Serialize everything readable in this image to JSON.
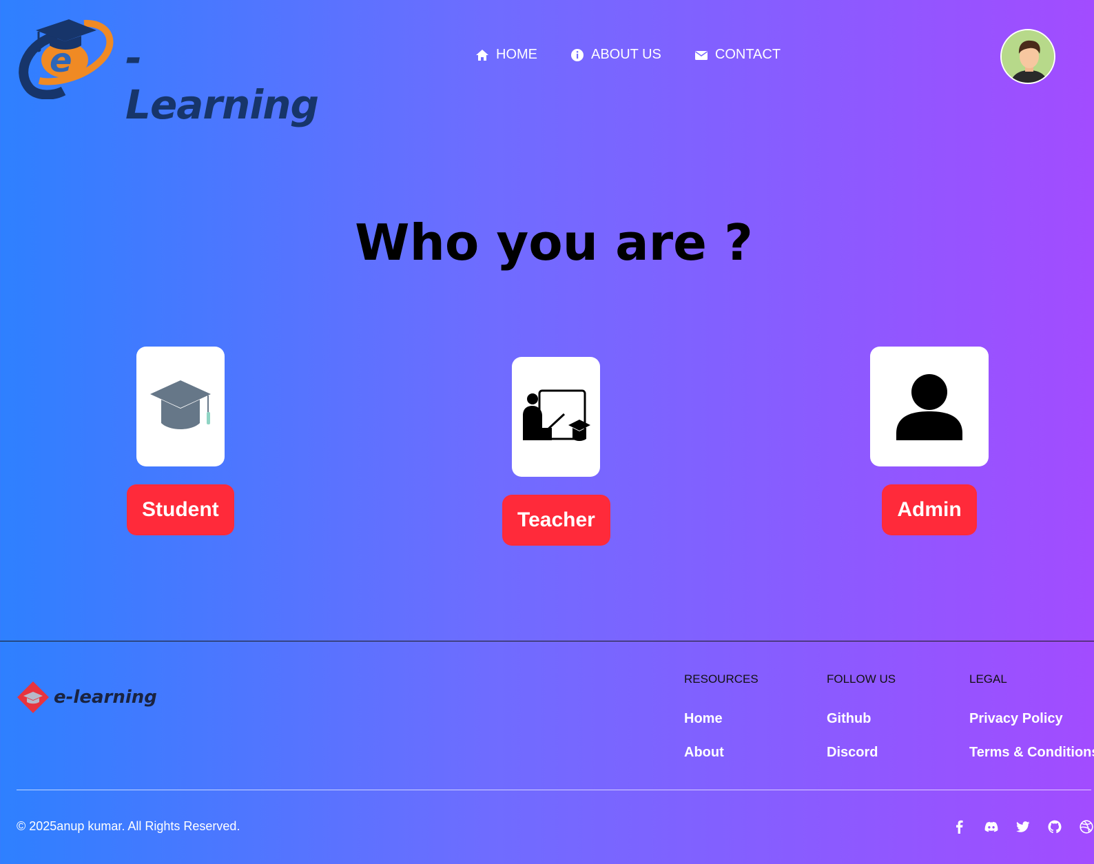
{
  "header": {
    "logo_text": "-Learning",
    "nav": [
      {
        "label": "HOME",
        "icon": "home-icon"
      },
      {
        "label": "ABOUT US",
        "icon": "info-icon"
      },
      {
        "label": "CONTACT",
        "icon": "envelope-icon"
      }
    ],
    "avatar_icon": "user-avatar"
  },
  "main": {
    "title": "Who you are ?",
    "roles": [
      {
        "label": "Student",
        "icon": "graduation-cap-icon"
      },
      {
        "label": "Teacher",
        "icon": "teacher-board-icon"
      },
      {
        "label": "Admin",
        "icon": "person-icon"
      }
    ]
  },
  "footer": {
    "logo_text": "e-learning",
    "columns": [
      {
        "heading": "RESOURCES",
        "links": [
          "Home",
          "About"
        ]
      },
      {
        "heading": "FOLLOW US",
        "links": [
          "Github",
          "Discord"
        ]
      },
      {
        "heading": "LEGAL",
        "links": [
          "Privacy Policy",
          "Terms & Conditions"
        ]
      }
    ],
    "copyright": "© 2025anup kumar. All Rights Reserved.",
    "socials": [
      "facebook-icon",
      "discord-icon",
      "twitter-icon",
      "github-icon",
      "dribbble-icon"
    ]
  },
  "colors": {
    "gradient_start": "#2e80ff",
    "gradient_end": "#a24cff",
    "role_button": "#ff2a3a",
    "logo_dark": "#17356a",
    "logo_orange": "#f08a24"
  }
}
